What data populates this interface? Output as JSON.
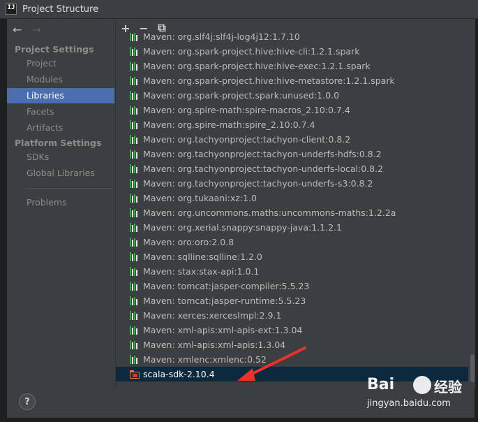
{
  "window": {
    "title": "Project Structure"
  },
  "sidebar": {
    "nav": {
      "back": "←",
      "forward": "→"
    },
    "sections": [
      {
        "label": "Project Settings"
      },
      {
        "label": "Platform Settings"
      }
    ],
    "items": [
      {
        "label": "Project"
      },
      {
        "label": "Modules"
      },
      {
        "label": "Libraries",
        "selected": true
      },
      {
        "label": "Facets"
      },
      {
        "label": "Artifacts"
      },
      {
        "label": "SDKs"
      },
      {
        "label": "Global Libraries"
      },
      {
        "label": "Problems"
      }
    ]
  },
  "toolbar": {
    "add": "+",
    "remove": "−",
    "copy": "⧉"
  },
  "libraries": [
    "Maven: org.slf4j:slf4j-log4j12:1.7.10",
    "Maven: org.spark-project.hive:hive-cli:1.2.1.spark",
    "Maven: org.spark-project.hive:hive-exec:1.2.1.spark",
    "Maven: org.spark-project.hive:hive-metastore:1.2.1.spark",
    "Maven: org.spark-project.spark:unused:1.0.0",
    "Maven: org.spire-math:spire-macros_2.10:0.7.4",
    "Maven: org.spire-math:spire_2.10:0.7.4",
    "Maven: org.tachyonproject:tachyon-client:0.8.2",
    "Maven: org.tachyonproject:tachyon-underfs-hdfs:0.8.2",
    "Maven: org.tachyonproject:tachyon-underfs-local:0.8.2",
    "Maven: org.tachyonproject:tachyon-underfs-s3:0.8.2",
    "Maven: org.tukaani:xz:1.0",
    "Maven: org.uncommons.maths:uncommons-maths:1.2.2a",
    "Maven: org.xerial.snappy:snappy-java:1.1.2.1",
    "Maven: oro:oro:2.0.8",
    "Maven: sqlline:sqlline:1.2.0",
    "Maven: stax:stax-api:1.0.1",
    "Maven: tomcat:jasper-compiler:5.5.23",
    "Maven: tomcat:jasper-runtime:5.5.23",
    "Maven: xerces:xercesImpl:2.9.1",
    "Maven: xml-apis:xml-apis-ext:1.3.04",
    "Maven: xml-apis:xml-apis:1.3.04",
    "Maven: xmlenc:xmlenc:0.52"
  ],
  "sdk": {
    "label": "scala-sdk-2.10.4",
    "selected": true
  },
  "help": {
    "label": "?"
  },
  "watermark": {
    "brand": "Bai",
    "brand_cn": "经验",
    "url": "jingyan.baidu.com"
  },
  "colors": {
    "selection": "#4b6eaf",
    "arrow": "#e8322a",
    "library_icon": "#499c54"
  }
}
